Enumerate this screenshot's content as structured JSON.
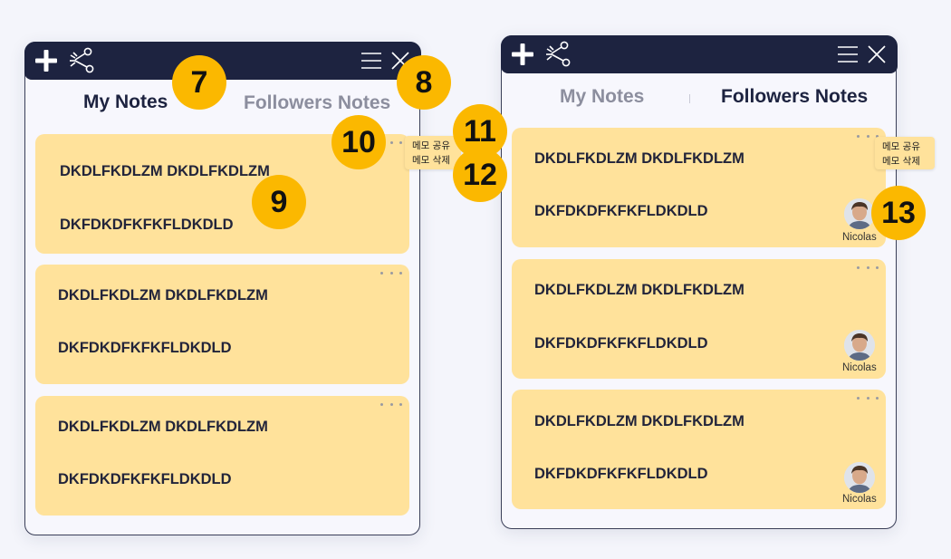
{
  "left_panel": {
    "tabs": {
      "my_notes": "My Notes",
      "followers_notes": "Followers Notes"
    },
    "active_tab": "my_notes",
    "notes": [
      {
        "line1": "DKDLFKDLZM DKDLFKDLZM",
        "line2": "DKFDKDFKFKFLDKDLD"
      },
      {
        "line1": "DKDLFKDLZM DKDLFKDLZM",
        "line2": "DKFDKDFKFKFLDKDLD"
      },
      {
        "line1": "DKDLFKDLZM DKDLFKDLZM",
        "line2": "DKFDKDFKFKFLDKDLD"
      }
    ],
    "context_menu": {
      "share": "메모 공유",
      "delete": "메모 삭제"
    }
  },
  "right_panel": {
    "tabs": {
      "my_notes": "My Notes",
      "followers_notes": "Followers Notes"
    },
    "active_tab": "followers_notes",
    "notes": [
      {
        "line1": "DKDLFKDLZM DKDLFKDLZM",
        "line2": "DKFDKDFKFKFLDKDLD",
        "author": "Nicolas"
      },
      {
        "line1": "DKDLFKDLZM DKDLFKDLZM",
        "line2": "DKFDKDFKFKFLDKDLD",
        "author": "Nicolas"
      },
      {
        "line1": "DKDLFKDLZM DKDLFKDLZM",
        "line2": "DKFDKDFKFKFLDKDLD",
        "author": "Nicolas"
      }
    ],
    "context_menu": {
      "share": "메모 공유",
      "delete": "메모 삭제"
    }
  },
  "annotations": [
    "7",
    "8",
    "9",
    "10",
    "11",
    "12",
    "13"
  ],
  "icons": {
    "add": "plus-icon",
    "share": "share-icon",
    "menu": "hamburger-menu-icon",
    "close": "close-icon",
    "more": "more-dots-icon"
  },
  "colors": {
    "topbar": "#1d2340",
    "note_background": "#ffe29b",
    "badge": "#fbb800",
    "active_tab_text": "#1d2340",
    "inactive_tab_text": "#8c8e9e"
  }
}
